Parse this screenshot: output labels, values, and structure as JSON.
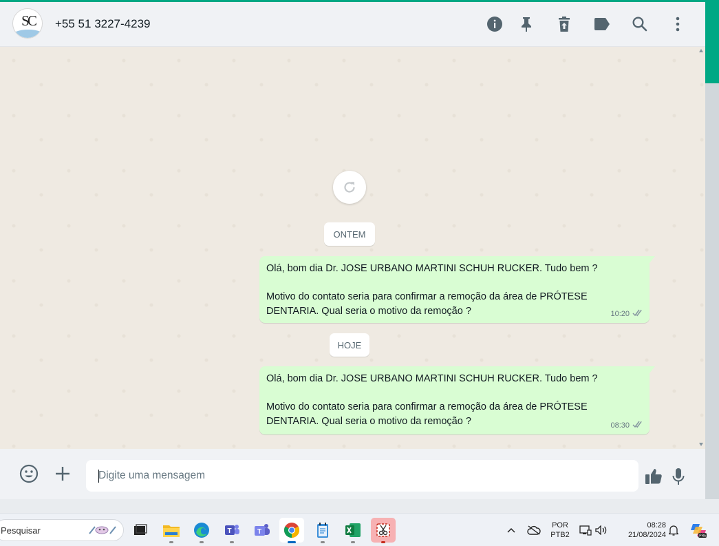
{
  "header": {
    "avatar_monogram": "SC",
    "contact_name": "+55 51 3227-4239",
    "icons": [
      "info-icon",
      "pin-icon",
      "delete-icon",
      "label-icon",
      "search-icon",
      "more-icon"
    ]
  },
  "chat": {
    "chips": {
      "yesterday": "ONTEM",
      "today": "HOJE"
    },
    "messages": [
      {
        "line1": "Olá, bom dia Dr. JOSE URBANO MARTINI SCHUH RUCKER. Tudo bem ?",
        "line2": "Motivo do contato seria para confirmar a remoção da área de PRÓTESE",
        "line3": "DENTARIA. Qual seria o motivo da remoção ?",
        "time": "10:20",
        "status": "read"
      },
      {
        "line1": "Olá, bom dia Dr. JOSE URBANO MARTINI SCHUH RUCKER. Tudo bem ?",
        "line2": "Motivo do contato seria para confirmar a remoção da área de PRÓTESE",
        "line3": "DENTARIA. Qual seria o motivo da remoção ?",
        "time": "08:30",
        "status": "read"
      }
    ]
  },
  "composer": {
    "placeholder": "Digite uma mensagem",
    "value": ""
  },
  "taskbar": {
    "search_label": "Pesquisar",
    "apps": [
      "task-view",
      "file-explorer",
      "edge",
      "teams-classic",
      "teams",
      "chrome",
      "notepad",
      "excel",
      "snipping-tool"
    ],
    "language_line1": "POR",
    "language_line2": "PTB2",
    "time": "08:28",
    "date": "21/08/2024"
  },
  "colors": {
    "accent": "#00a884",
    "bubble_out": "#d9fdd3",
    "chat_bg": "#efeae2",
    "panel": "#f0f2f5",
    "read_ticks": "#8696a0"
  }
}
